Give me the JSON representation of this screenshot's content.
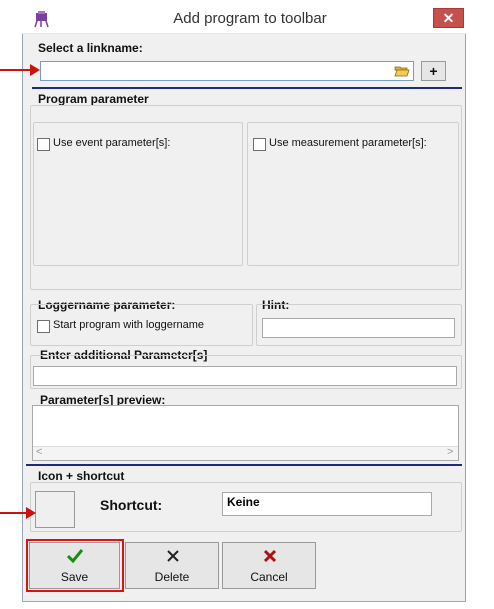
{
  "window": {
    "title": "Add program to toolbar",
    "close_glyph": "✕"
  },
  "linkname": {
    "heading": "Select a linkname:",
    "value": "",
    "add_glyph": "+"
  },
  "program_parameter": {
    "heading": "Program parameter",
    "use_event": "Use event parameter[s]:",
    "use_measurement": "Use measurement parameter[s]:"
  },
  "loggername": {
    "heading": "Loggername parameter:",
    "start_with": "Start program with loggername"
  },
  "hint": {
    "heading": "Hint:",
    "value": ""
  },
  "additional": {
    "heading": "Enter additional Parameter[s]",
    "value": ""
  },
  "preview": {
    "heading": "Parameter[s] preview:",
    "scroll_left": "<",
    "scroll_right": ">"
  },
  "icon_shortcut": {
    "heading": "Icon + shortcut",
    "shortcut_label": "Shortcut:",
    "shortcut_value": "Keine"
  },
  "buttons": {
    "save": "Save",
    "delete": "Delete",
    "cancel": "Cancel"
  },
  "colors": {
    "accent_line": "#1c2a80",
    "annotation_red": "#cc1111",
    "close_red": "#c7504d",
    "save_check_green": "#1a8a1a",
    "cancel_x_red": "#b01010"
  },
  "icons": [
    "app-icon",
    "folder-open-icon",
    "plus-icon",
    "check-icon",
    "delete-x-icon",
    "cancel-x-icon"
  ]
}
